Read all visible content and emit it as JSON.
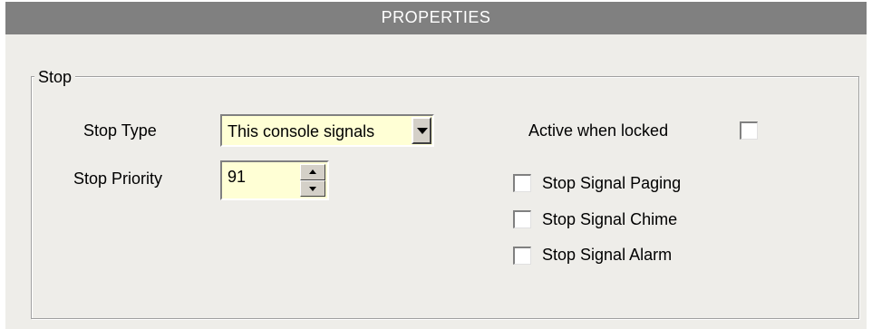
{
  "window": {
    "title": "PROPERTIES"
  },
  "stop_group": {
    "legend": "Stop",
    "stop_type": {
      "label": "Stop Type",
      "value": "This console signals"
    },
    "stop_priority": {
      "label": "Stop Priority",
      "value": "91"
    },
    "active_when_locked": {
      "label": "Active when locked",
      "checked": false
    },
    "options": [
      {
        "label": "Stop Signal Paging",
        "checked": false
      },
      {
        "label": "Stop Signal Chime",
        "checked": false
      },
      {
        "label": "Stop Signal Alarm",
        "checked": false
      }
    ]
  },
  "colors": {
    "titlebar_bg": "#808080",
    "panel_bg": "#eeede9",
    "input_bg": "#ffffd5"
  },
  "icons": [
    "chevron-down-icon",
    "spin-up-icon",
    "spin-down-icon"
  ]
}
